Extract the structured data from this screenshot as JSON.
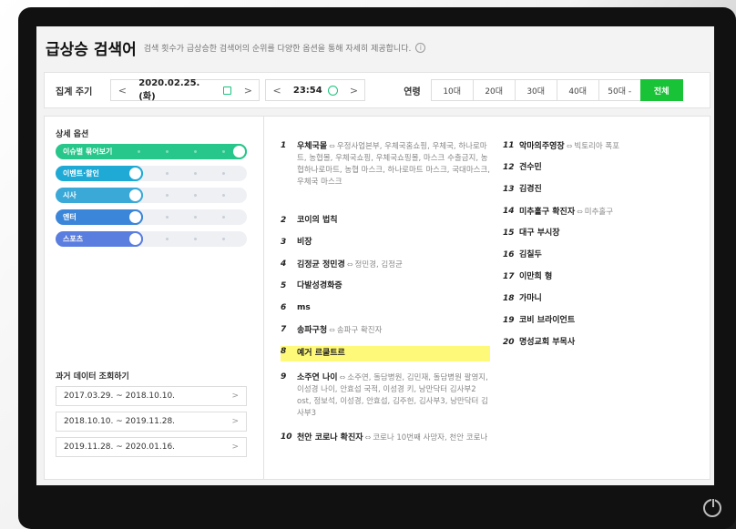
{
  "header": {
    "title": "급상승 검색어",
    "description": "검색 횟수가 급상승한 검색어의 순위를 다양한 옵션을 통해 자세히 제공합니다.",
    "info": "i"
  },
  "filter": {
    "period_label": "집계 주기",
    "date": "2020.02.25. (화)",
    "time": "23:54",
    "prev": "<",
    "next": ">",
    "age_label": "연령",
    "ages": [
      "10대",
      "20대",
      "30대",
      "40대",
      "50대 -",
      "전체"
    ],
    "active_age": "전체"
  },
  "options": {
    "title": "상세 옵션",
    "toggles": [
      {
        "label": "이슈별 묶어보기",
        "color": "#27c68a",
        "state": "on"
      },
      {
        "label": "이벤트·할인",
        "color": "#1faad6",
        "state": "off"
      },
      {
        "label": "시사",
        "color": "#3aa9d8",
        "state": "off"
      },
      {
        "label": "엔터",
        "color": "#3c86d9",
        "state": "off"
      },
      {
        "label": "스포츠",
        "color": "#5a7de0",
        "state": "off"
      }
    ]
  },
  "history": {
    "title": "과거 데이터 조회하기",
    "ranges": [
      "2017.03.29. ~ 2018.10.10.",
      "2018.10.10. ~ 2019.11.28.",
      "2019.11.28. ~ 2020.01.16."
    ],
    "chevron": ">"
  },
  "ranks_left": [
    {
      "rank": "1",
      "keyword": "우체국몰",
      "related": "우정사업본부, 우체국홈쇼핑, 우체국, 하나로마트, 농협몰, 우체국쇼핑, 우체국쇼핑몰, 마스크 수출금지, 농협하나로마트, 농협 마스크, 하나로마트 마스크, 국대마스크, 우체국 마스크"
    },
    {
      "rank": "2",
      "keyword": "코이의 법칙",
      "related": ""
    },
    {
      "rank": "3",
      "keyword": "비장",
      "related": ""
    },
    {
      "rank": "4",
      "keyword": "김정균 정민경",
      "related": "정민경, 김정균"
    },
    {
      "rank": "5",
      "keyword": "다발성경화증",
      "related": ""
    },
    {
      "rank": "6",
      "keyword": "ms",
      "related": ""
    },
    {
      "rank": "7",
      "keyword": "송파구청",
      "related": "송파구 확진자"
    },
    {
      "rank": "8",
      "keyword": "예거 르쿨트르",
      "related": ""
    },
    {
      "rank": "9",
      "keyword": "소주연 나이",
      "related": "소주연, 돌담병원, 김민재, 돌담병원 팔영지, 이성경 나이, 안효섭 국적, 이성경 키, 낭만닥터 김사부2 ost, 정보석, 이성경, 안효섭, 김주헌, 김사부3, 낭만닥터 김사부3"
    },
    {
      "rank": "10",
      "keyword": "천안 코로나 확진자",
      "related": "코로나 10번째 사망자, 천안 코로나"
    }
  ],
  "ranks_right": [
    {
      "rank": "11",
      "keyword": "악마의주영장",
      "related": "빅토리아 폭포"
    },
    {
      "rank": "12",
      "keyword": "견수민",
      "related": ""
    },
    {
      "rank": "13",
      "keyword": "김경진",
      "related": ""
    },
    {
      "rank": "14",
      "keyword": "미추홀구 확진자",
      "related": "미추홀구"
    },
    {
      "rank": "15",
      "keyword": "대구 부시장",
      "related": ""
    },
    {
      "rank": "16",
      "keyword": "김칠두",
      "related": ""
    },
    {
      "rank": "17",
      "keyword": "이만희 형",
      "related": ""
    },
    {
      "rank": "18",
      "keyword": "가마니",
      "related": ""
    },
    {
      "rank": "19",
      "keyword": "코비 브라이언트",
      "related": ""
    },
    {
      "rank": "20",
      "keyword": "명성교회 부목사",
      "related": ""
    }
  ],
  "related_symbol": "⇔",
  "colors": {
    "accent": "#19c337",
    "highlight": "#fff97a"
  }
}
